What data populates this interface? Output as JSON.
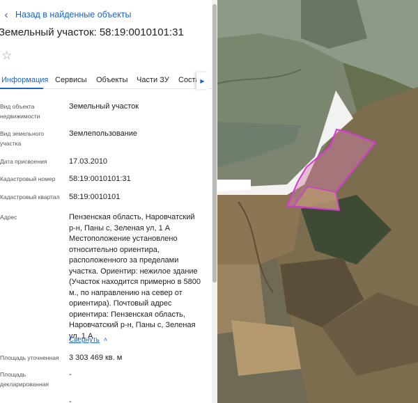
{
  "nav": {
    "back_label": "Назад в найденные объекты",
    "back_icon": "chevron-left-icon"
  },
  "header": {
    "title": "Земельный участок: 58:19:0010101:31",
    "favorite_icon": "star-outline-icon"
  },
  "tabs": [
    {
      "label": "Информация",
      "active": true
    },
    {
      "label": "Сервисы",
      "active": false
    },
    {
      "label": "Объекты",
      "active": false
    },
    {
      "label": "Части ЗУ",
      "active": false
    },
    {
      "label": "Соста",
      "active": false
    }
  ],
  "tabs_scroll_icon": "chevron-right-icon",
  "info": {
    "object_type": {
      "label": "Вид объекта недвижимости",
      "value": "Земельный участок"
    },
    "land_type": {
      "label": "Вид земельного участка",
      "value": "Землепользование"
    },
    "assigned_date": {
      "label": "Дата присвоения",
      "value": "17.03.2010"
    },
    "cadastral_number": {
      "label": "Кадастровый номер",
      "value": "58:19:0010101:31"
    },
    "cadastral_quarter": {
      "label": "Кадастровый квартал",
      "value": "58:19:0010101"
    },
    "address": {
      "label": "Адрес",
      "value": "Пензенская область, Наровчатский р-н, Паны с, Зеленая ул, 1 А Местоположение установлено относительно ориентира, расположенного за пределами участка. Ориентир: нежилое здание (Участок находится примерно в 5800 м., по направлению на север от ориентира). Почтовый адрес ориентира: Пензенская область, Наровчатский р-н, Паны с, Зеленая ул, 1 А",
      "collapse_label": "Свернуть",
      "collapse_icon": "chevron-up-icon"
    },
    "area_specified": {
      "label": "Площадь уточненная",
      "value": "3 303 469 кв. м"
    },
    "area_declared": {
      "label": "Площадь декларированная",
      "value": "-"
    }
  },
  "colors": {
    "accent": "#1a64c8",
    "parcel_outline": "#d13ad6",
    "parcel_fill": "#d77fb0"
  }
}
